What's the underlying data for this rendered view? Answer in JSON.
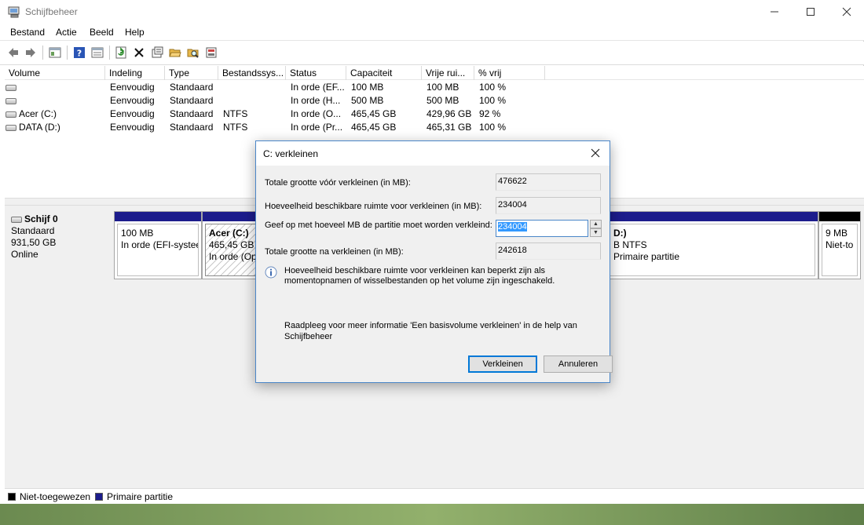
{
  "window": {
    "title": "Schijfbeheer"
  },
  "menu": [
    "Bestand",
    "Actie",
    "Beeld",
    "Help"
  ],
  "toolbar": [
    "back-icon",
    "forward-icon",
    "console-tree-icon",
    "help-icon",
    "list-view-icon",
    "refresh-icon",
    "delete-icon",
    "properties-icon",
    "open-icon",
    "explore-icon",
    "settings-icon"
  ],
  "volumes": {
    "columns": [
      "Volume",
      "Indeling",
      "Type",
      "Bestandssys...",
      "Status",
      "Capaciteit",
      "Vrije rui...",
      "% vrij"
    ],
    "rows": [
      [
        "",
        "Eenvoudig",
        "Standaard",
        "",
        "In orde (EF...",
        "100 MB",
        "100 MB",
        "100 %"
      ],
      [
        "",
        "Eenvoudig",
        "Standaard",
        "",
        "In orde (H...",
        "500 MB",
        "500 MB",
        "100 %"
      ],
      [
        "Acer (C:)",
        "Eenvoudig",
        "Standaard",
        "NTFS",
        "In orde (O...",
        "465,45 GB",
        "429,96 GB",
        "92 %"
      ],
      [
        "DATA (D:)",
        "Eenvoudig",
        "Standaard",
        "NTFS",
        "In orde (Pr...",
        "465,45 GB",
        "465,31 GB",
        "100 %"
      ]
    ]
  },
  "disk": {
    "name": "Schijf 0",
    "type": "Standaard",
    "size": "931,50 GB",
    "status": "Online",
    "partitions": [
      {
        "name": "",
        "size": "100 MB",
        "status": "In orde (EFI-systee"
      },
      {
        "name": "Acer  (C:)",
        "size": "465,45 GB N",
        "status": "In orde (Op"
      },
      {
        "name": "D:)",
        "size": "B NTFS",
        "status": "Primaire partitie"
      },
      {
        "name": "",
        "size": "9 MB",
        "status": "Niet-to"
      }
    ]
  },
  "legend": [
    {
      "label": "Niet-toegewezen",
      "color": "#000000"
    },
    {
      "label": "Primaire partitie",
      "color": "#1c1c8c"
    }
  ],
  "dialog": {
    "title": "C: verkleinen",
    "total_label": "Totale grootte vóór verkleinen (in MB):",
    "total_value": "476622",
    "available_label": "Hoeveelheid beschikbare ruimte voor verkleinen (in MB):",
    "available_value": "234004",
    "shrink_label": "Geef op met hoeveel MB de partitie moet worden verkleind:",
    "shrink_value": "234004",
    "after_label": "Totale grootte na verkleinen (in MB):",
    "after_value": "242618",
    "info": "Hoeveelheid beschikbare ruimte voor verkleinen kan beperkt zijn als momentopnamen of wisselbestanden op het volume zijn ingeschakeld.",
    "help": "Raadpleeg voor meer informatie 'Een basisvolume verkleinen' in de help van Schijfbeheer",
    "shrink_button": "Verkleinen",
    "cancel_button": "Annuleren"
  }
}
